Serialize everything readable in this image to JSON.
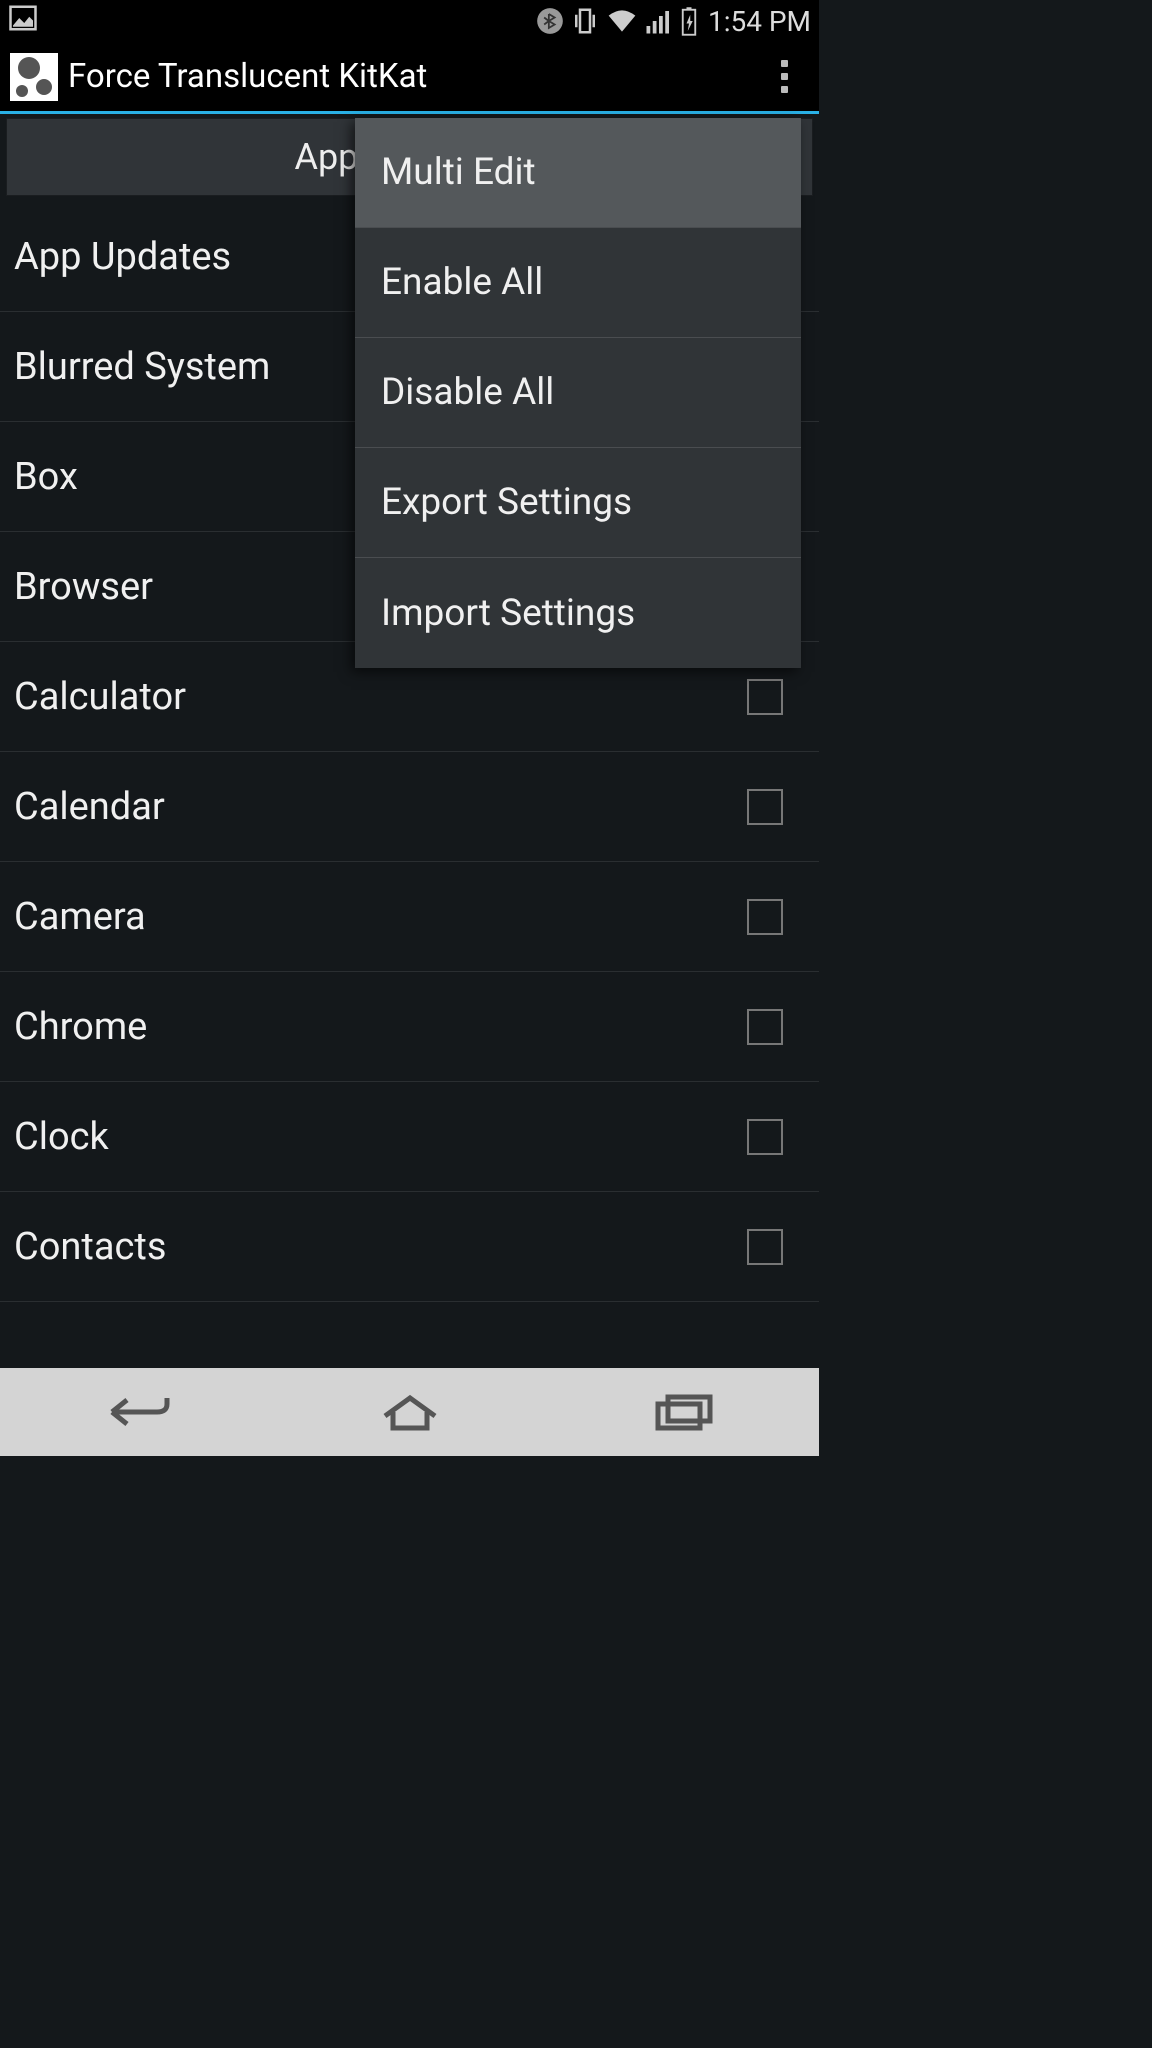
{
  "status": {
    "time": "1:54 PM"
  },
  "actionBar": {
    "title": "Force Translucent KitKat"
  },
  "applyButton": "Apply Settings",
  "apps": [
    {
      "name": "App Updates"
    },
    {
      "name": "Blurred System"
    },
    {
      "name": "Box"
    },
    {
      "name": "Browser"
    },
    {
      "name": "Calculator"
    },
    {
      "name": "Calendar"
    },
    {
      "name": "Camera"
    },
    {
      "name": "Chrome"
    },
    {
      "name": "Clock"
    },
    {
      "name": "Contacts"
    }
  ],
  "menu": {
    "items": [
      "Multi Edit",
      "Enable All",
      "Disable All",
      "Export Settings",
      "Import Settings"
    ]
  }
}
